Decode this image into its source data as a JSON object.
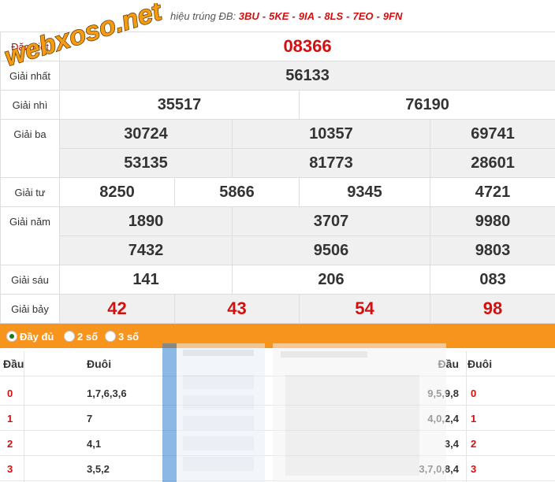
{
  "header": {
    "prefix": "hiệu trúng ĐB:",
    "codes": [
      "3BU",
      "5KE",
      "9IA",
      "8LS",
      "7EO",
      "9FN"
    ],
    "separator": "-"
  },
  "logo": {
    "text": "webxoso.net"
  },
  "prizes": {
    "dac_biet": {
      "label": "Đặc biệt",
      "numbers": [
        "08366"
      ]
    },
    "nhat": {
      "label": "Giải nhất",
      "numbers": [
        "56133"
      ]
    },
    "nhi": {
      "label": "Giải nhì",
      "numbers": [
        "35517",
        "76190"
      ]
    },
    "ba": {
      "label": "Giải ba",
      "numbers": [
        "30724",
        "10357",
        "69741",
        "53135",
        "81773",
        "28601"
      ]
    },
    "tu": {
      "label": "Giải tư",
      "numbers": [
        "8250",
        "5866",
        "9345",
        "4721"
      ]
    },
    "nam": {
      "label": "Giải năm",
      "numbers": [
        "1890",
        "3707",
        "9980",
        "7432",
        "9506",
        "9803"
      ]
    },
    "sau": {
      "label": "Giải sáu",
      "numbers": [
        "141",
        "206",
        "083"
      ]
    },
    "bay": {
      "label": "Giải bảy",
      "numbers": [
        "42",
        "43",
        "54",
        "98"
      ]
    }
  },
  "options": {
    "full": "Đầy đủ",
    "two": "2 số",
    "three": "3 số",
    "selected": "full"
  },
  "dau_duoi": {
    "headers": {
      "dau": "Đầu",
      "duoi": "Đuôi"
    },
    "left": [
      {
        "dau": "0",
        "duoi": "1,7,6,3,6"
      },
      {
        "dau": "1",
        "duoi": "7"
      },
      {
        "dau": "2",
        "duoi": "4,1"
      },
      {
        "dau": "3",
        "duoi": "3,5,2"
      }
    ],
    "right": [
      {
        "dau": "9,5,9,8",
        "duoi": "0"
      },
      {
        "dau": "4,0,2,4",
        "duoi": "1"
      },
      {
        "dau": "3,4",
        "duoi": "2"
      },
      {
        "dau": "3,7,0,8,4",
        "duoi": "3"
      }
    ]
  },
  "colors": {
    "accent_red": "#d21010",
    "orange_bar": "#f7941d",
    "logo_orange": "#f39c12",
    "row_gray": "#f0f0f0"
  }
}
